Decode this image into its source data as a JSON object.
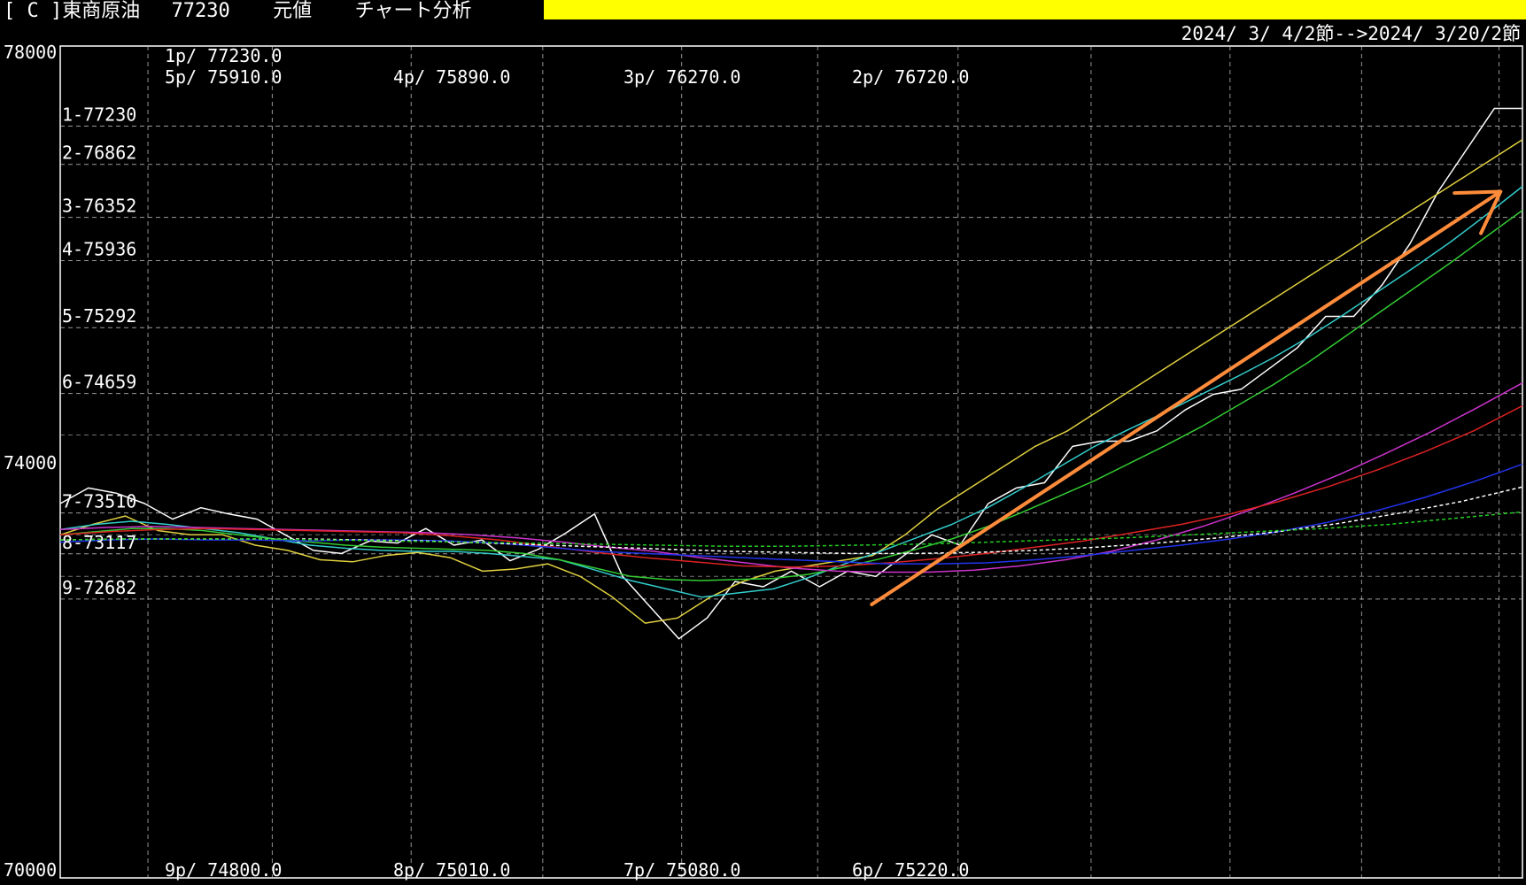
{
  "header": {
    "title": "[ C ]東商原油　 77230 　 元値 　 チャート分析",
    "date_range": "2024/ 3/ 4/2節-->2024/ 3/20/2節"
  },
  "colors": {
    "background": "#000000",
    "header_accent": "#ffff00",
    "grid": "#cfcfcf",
    "annotation_arrow": "#ff8c3a"
  },
  "chart_data": {
    "type": "line",
    "title": "東商原油",
    "ylim": [
      70000,
      78000
    ],
    "y_axis_labels": [
      "78000",
      "74000",
      "70000"
    ],
    "grid": true,
    "levels": [
      {
        "label": "1-77230",
        "value": 77230
      },
      {
        "label": "2-76862",
        "value": 76862
      },
      {
        "label": "3-76352",
        "value": 76352
      },
      {
        "label": "4-75936",
        "value": 75936
      },
      {
        "label": "5-75292",
        "value": 75292
      },
      {
        "label": "6-74659",
        "value": 74659
      },
      {
        "label": "7-73510",
        "value": 73510
      },
      {
        "label": "8-73117",
        "value": 73117
      },
      {
        "label": "9-72682",
        "value": 72682
      }
    ],
    "period_labels_top": [
      "1p/ 77230.0",
      "5p/ 75910.0",
      "4p/ 75890.0",
      "3p/ 76270.0",
      "2p/ 76720.0"
    ],
    "period_labels_bottom": [
      "9p/ 74800.0",
      "8p/ 75010.0",
      "7p/ 75080.0",
      "6p/ 75220.0"
    ],
    "series": [
      {
        "color": "#ffffff",
        "style": "solid",
        "values": [
          73600,
          73750,
          73700,
          73600,
          73450,
          73560,
          73500,
          73450,
          73300,
          73150,
          73120,
          73240,
          73220,
          73360,
          73200,
          73250,
          73050,
          73160,
          73320,
          73500,
          72900,
          72600,
          72300,
          72500,
          72850,
          72800,
          72950,
          72800,
          72950,
          72900,
          73100,
          73300,
          73200,
          73600,
          73750,
          73800,
          74150,
          74200,
          74200,
          74300,
          74500,
          74650,
          74700,
          74900,
          75100,
          75400,
          75400,
          75700,
          76100,
          76600,
          77000,
          77400,
          77400
        ]
      },
      {
        "color": "#e0d040",
        "style": "solid",
        "values": [
          73300,
          73400,
          73480,
          73340,
          73300,
          73300,
          73200,
          73150,
          73060,
          73040,
          73100,
          73130,
          73080,
          72950,
          72970,
          73020,
          72900,
          72700,
          72450,
          72500,
          72700,
          72850,
          72950,
          73000,
          73050,
          73100,
          73300,
          73550,
          73750,
          73950,
          74150,
          74300,
          74500,
          74700,
          74900,
          75100,
          75300,
          75500,
          75700,
          75900,
          76100,
          76300,
          76500,
          76700,
          76900,
          77100
        ]
      },
      {
        "color": "#33cccc",
        "style": "solid",
        "values": [
          73350,
          73400,
          73430,
          73400,
          73360,
          73320,
          73260,
          73200,
          73170,
          73150,
          73140,
          73140,
          73120,
          73090,
          73060,
          72960,
          72860,
          72780,
          72700,
          72740,
          72780,
          72890,
          73020,
          73140,
          73270,
          73400,
          73560,
          73750,
          73950,
          74150,
          74320,
          74480,
          74650,
          74820,
          75000,
          75200,
          75420,
          75650,
          75880,
          76120,
          76380,
          76650
        ]
      },
      {
        "color": "#33cc33",
        "style": "solid",
        "values": [
          73300,
          73330,
          73360,
          73360,
          73340,
          73300,
          73260,
          73230,
          73200,
          73180,
          73170,
          73160,
          73150,
          73120,
          73060,
          72980,
          72900,
          72870,
          72860,
          72870,
          72880,
          72920,
          72990,
          73070,
          73160,
          73260,
          73380,
          73520,
          73670,
          73820,
          73990,
          74160,
          74340,
          74540,
          74740,
          74960,
          75200,
          75440,
          75680,
          75920,
          76170,
          76420
        ]
      },
      {
        "color": "#cc33cc",
        "style": "solid",
        "values": [
          73350,
          73370,
          73380,
          73370,
          73360,
          73350,
          73340,
          73330,
          73320,
          73300,
          73270,
          73230,
          73180,
          73140,
          73080,
          73030,
          72980,
          72950,
          72940,
          72940,
          72960,
          73000,
          73060,
          73140,
          73250,
          73380,
          73530,
          73700,
          73880,
          74080,
          74290,
          74520,
          74760
        ]
      },
      {
        "color": "#dd2222",
        "style": "solid",
        "values": [
          73300,
          73330,
          73350,
          73360,
          73350,
          73340,
          73330,
          73320,
          73290,
          73250,
          73190,
          73130,
          73080,
          73040,
          73000,
          72990,
          73000,
          73030,
          73070,
          73120,
          73180,
          73240,
          73320,
          73400,
          73500,
          73620,
          73760,
          73920,
          74100,
          74300,
          74540
        ]
      },
      {
        "color": "#2233ee",
        "style": "solid",
        "values": [
          73230,
          73250,
          73260,
          73250,
          73250,
          73240,
          73250,
          73250,
          73240,
          73220,
          73180,
          73140,
          73120,
          73100,
          73080,
          73060,
          73040,
          73020,
          73020,
          73030,
          73060,
          73100,
          73150,
          73200,
          73260,
          73330,
          73420,
          73530,
          73660,
          73810,
          73980
        ]
      },
      {
        "color": "#ffffff",
        "style": "dashed",
        "values": [
          73250,
          73260,
          73260,
          73260,
          73260,
          73250,
          73240,
          73220,
          73200,
          73180,
          73160,
          73140,
          73130,
          73120,
          73120,
          73130,
          73150,
          73180,
          73220,
          73270,
          73330,
          73410,
          73510,
          73620,
          73760
        ]
      },
      {
        "color": "#22cc22",
        "style": "dashed",
        "values": [
          73250,
          73260,
          73260,
          73260,
          73250,
          73240,
          73230,
          73220,
          73210,
          73200,
          73190,
          73190,
          73200,
          73210,
          73230,
          73250,
          73270,
          73300,
          73330,
          73360,
          73400,
          73460,
          73520
        ]
      }
    ],
    "annotation": {
      "type": "arrow",
      "color": "#ff8c3a",
      "from": [
        0.555,
        72630
      ],
      "to": [
        0.985,
        76600
      ]
    }
  }
}
